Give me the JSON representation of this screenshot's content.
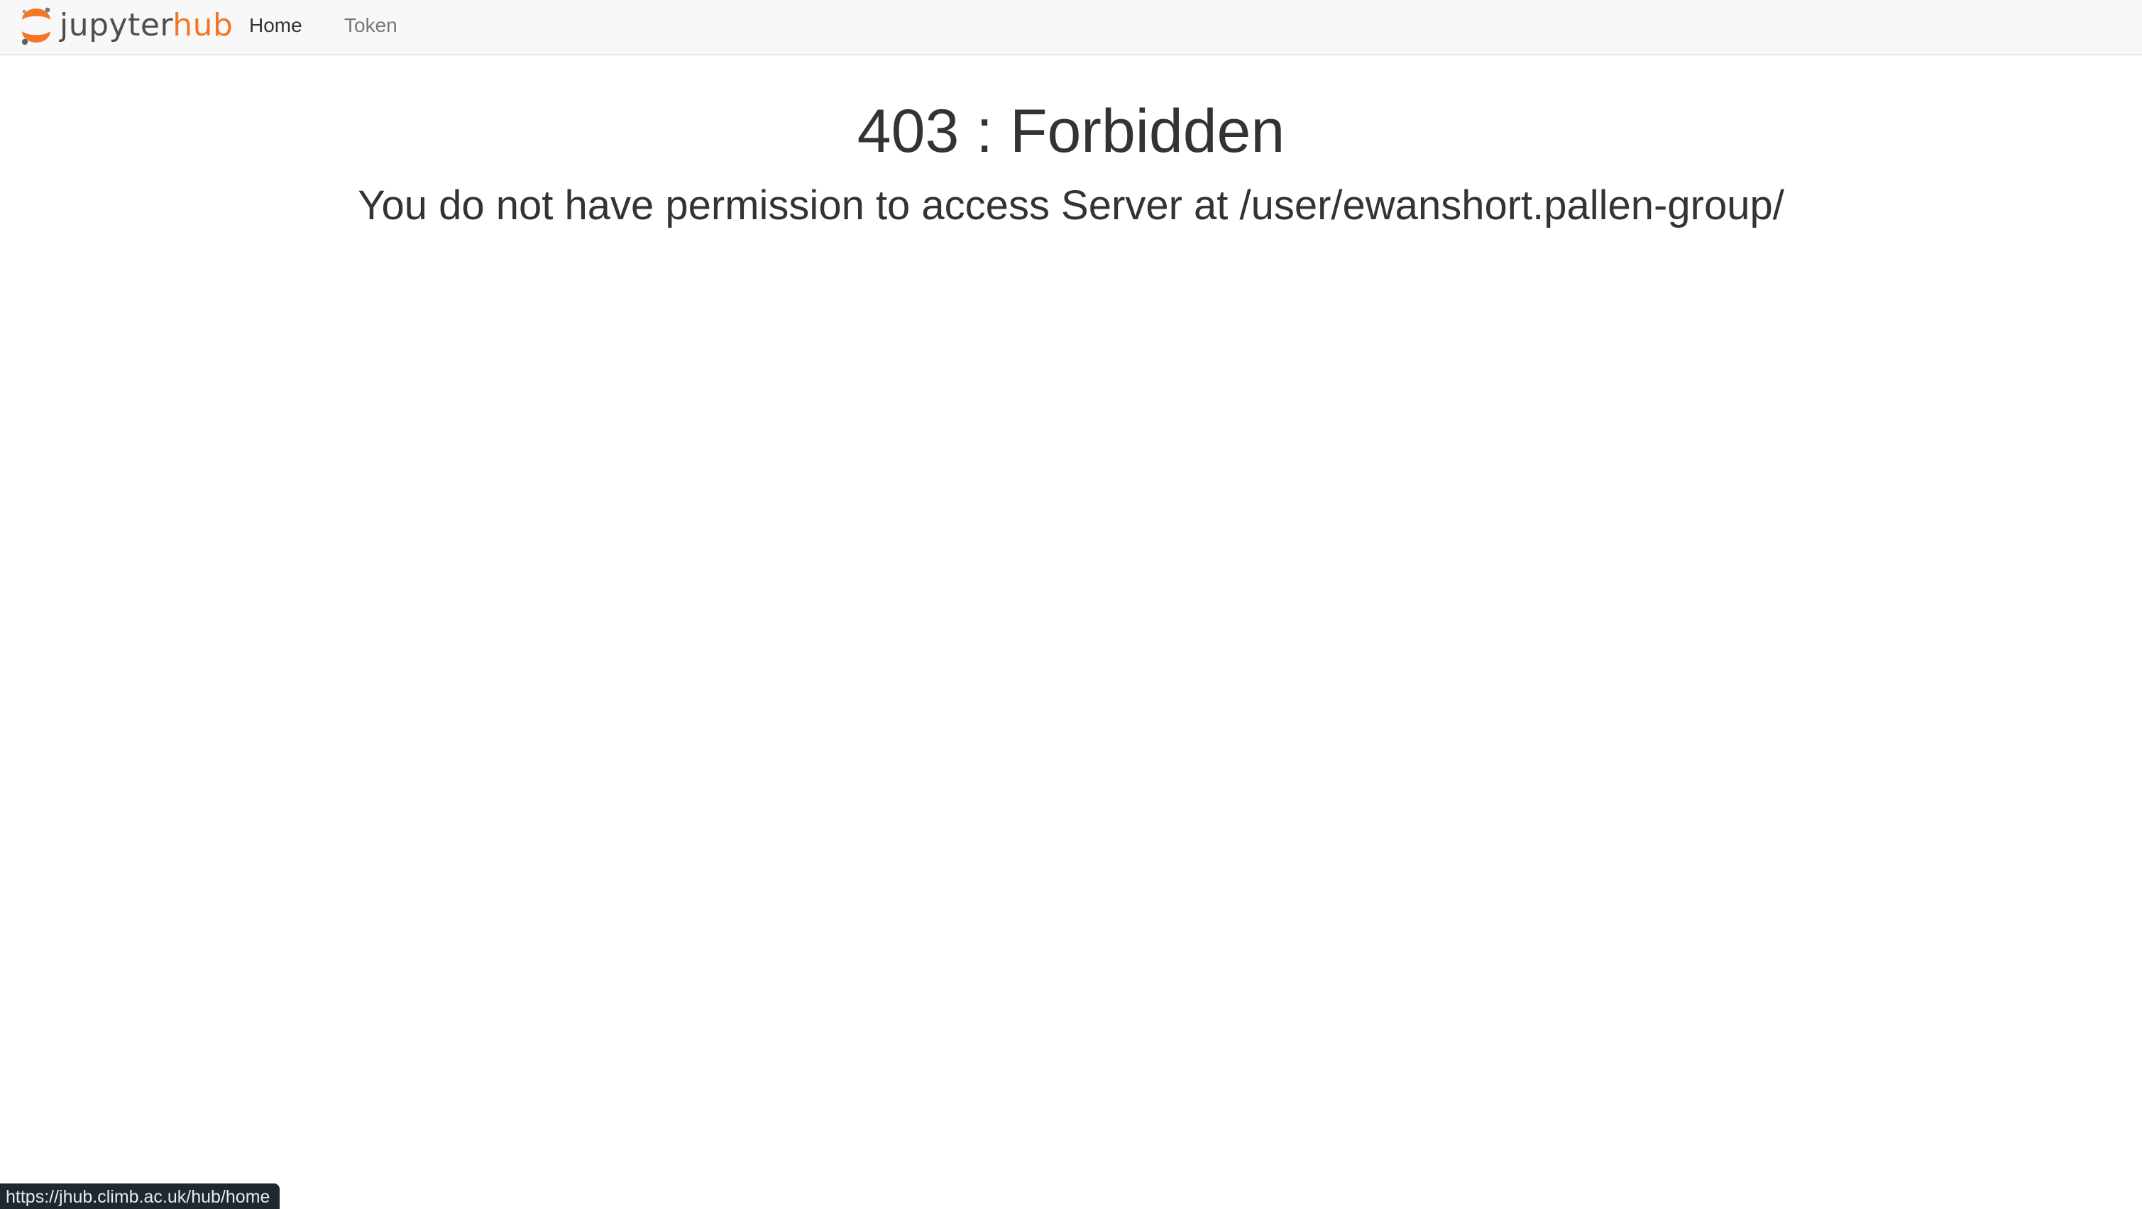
{
  "navbar": {
    "brand": {
      "logo_icon": "jupyter-logo-icon",
      "text_primary": "jupyter",
      "text_accent": "hub",
      "accent_color": "#f37726"
    },
    "links": [
      {
        "label": "Home"
      },
      {
        "label": "Token"
      }
    ]
  },
  "error": {
    "title": "403 : Forbidden",
    "message": "You do not have permission to access Server at /user/ewanshort.pallen-group/"
  },
  "status_bar": {
    "url": "https://jhub.climb.ac.uk/hub/home"
  }
}
